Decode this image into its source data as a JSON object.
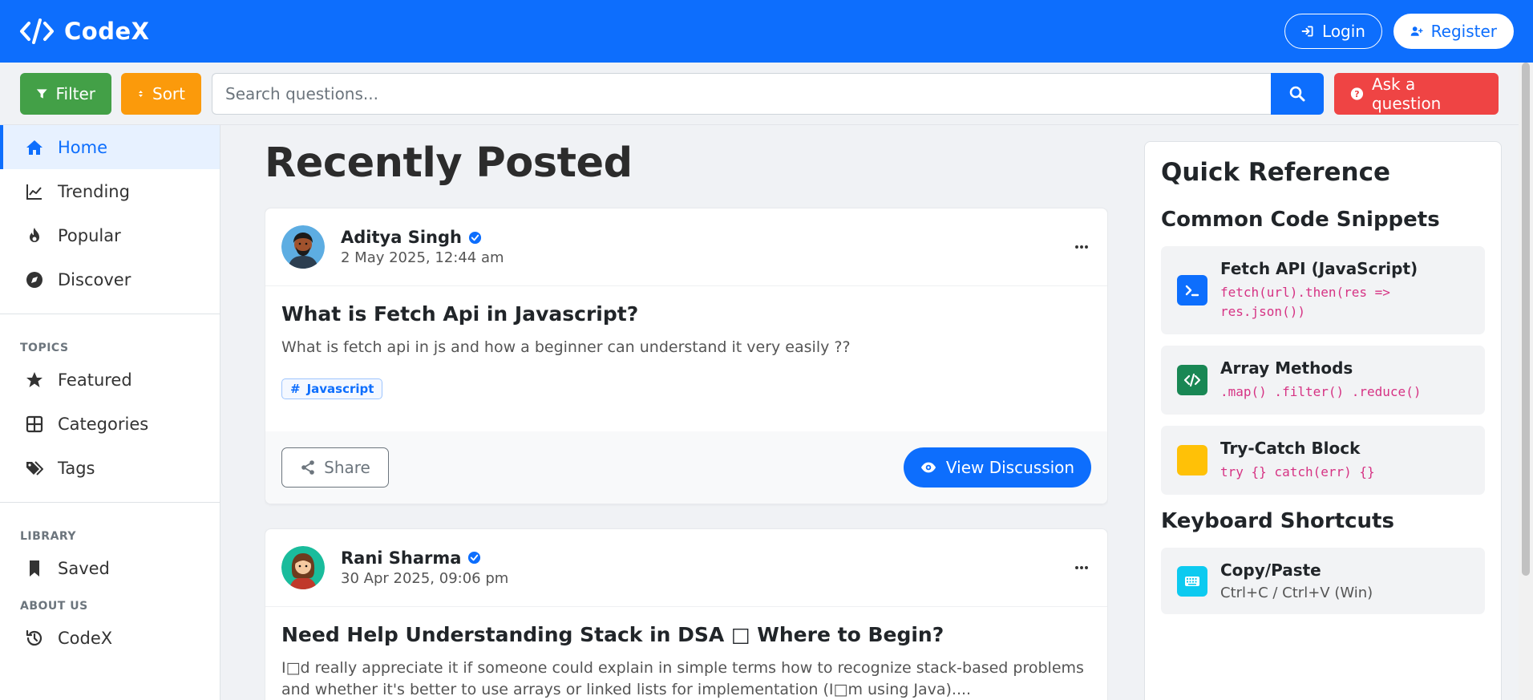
{
  "brand": {
    "name": "CodeX"
  },
  "nav": {
    "login_label": "Login",
    "register_label": "Register"
  },
  "toolbar": {
    "filter_label": "Filter",
    "sort_label": "Sort",
    "search_placeholder": "Search questions...",
    "ask_label": "Ask a question"
  },
  "sidebar": {
    "main_items": [
      {
        "label": "Home",
        "icon": "home-icon",
        "active": true
      },
      {
        "label": "Trending",
        "icon": "trending-icon"
      },
      {
        "label": "Popular",
        "icon": "fire-icon"
      },
      {
        "label": "Discover",
        "icon": "compass-icon"
      }
    ],
    "topics_heading": "TOPICS",
    "topic_items": [
      {
        "label": "Featured",
        "icon": "star-icon"
      },
      {
        "label": "Categories",
        "icon": "grid-icon"
      },
      {
        "label": "Tags",
        "icon": "tags-icon"
      }
    ],
    "library_heading": "LIBRARY",
    "library_items": [
      {
        "label": "Saved",
        "icon": "bookmark-icon"
      }
    ],
    "about_heading": "ABOUT US",
    "about_items": [
      {
        "label": "CodeX",
        "icon": "history-icon"
      }
    ]
  },
  "main": {
    "title": "Recently Posted",
    "posts": [
      {
        "author": "Aditya Singh",
        "date": "2 May 2025, 12:44 am",
        "title": "What is Fetch Api in Javascript?",
        "excerpt": "What is fetch api in js and how a beginner can understand it very easily ??",
        "tag": "Javascript",
        "share_label": "Share",
        "view_label": "View Discussion"
      },
      {
        "author": "Rani Sharma",
        "date": "30 Apr 2025, 09:06 pm",
        "title": "Need Help Understanding Stack in DSA □ Where to Begin?",
        "excerpt": "I□d really appreciate it if someone could explain in simple terms how to recognize stack-based problems and whether it's better to use arrays or linked lists for implementation (I□m using Java)...."
      }
    ]
  },
  "panel": {
    "title": "Quick Reference",
    "snippets_heading": "Common Code Snippets",
    "snippets": [
      {
        "title": "Fetch API (JavaScript)",
        "code": "fetch(url).then(res => res.json())",
        "icon": "terminal-icon",
        "color": "#0d6efd"
      },
      {
        "title": "Array Methods",
        "code": ".map() .filter() .reduce()",
        "icon": "code-icon",
        "color": "#198754"
      },
      {
        "title": "Try-Catch Block",
        "code": "try {} catch(err) {}",
        "icon": "warning-icon",
        "color": "#ffc107"
      }
    ],
    "shortcuts_heading": "Keyboard Shortcuts",
    "shortcuts": [
      {
        "title": "Copy/Paste",
        "text": "Ctrl+C / Ctrl+V (Win)",
        "icon": "keyboard-icon",
        "color": "#0dcaf0"
      }
    ]
  },
  "colors": {
    "primary": "#0d6efd",
    "filter": "#43a047",
    "sort": "#fb9a0b",
    "ask": "#ef4444"
  }
}
